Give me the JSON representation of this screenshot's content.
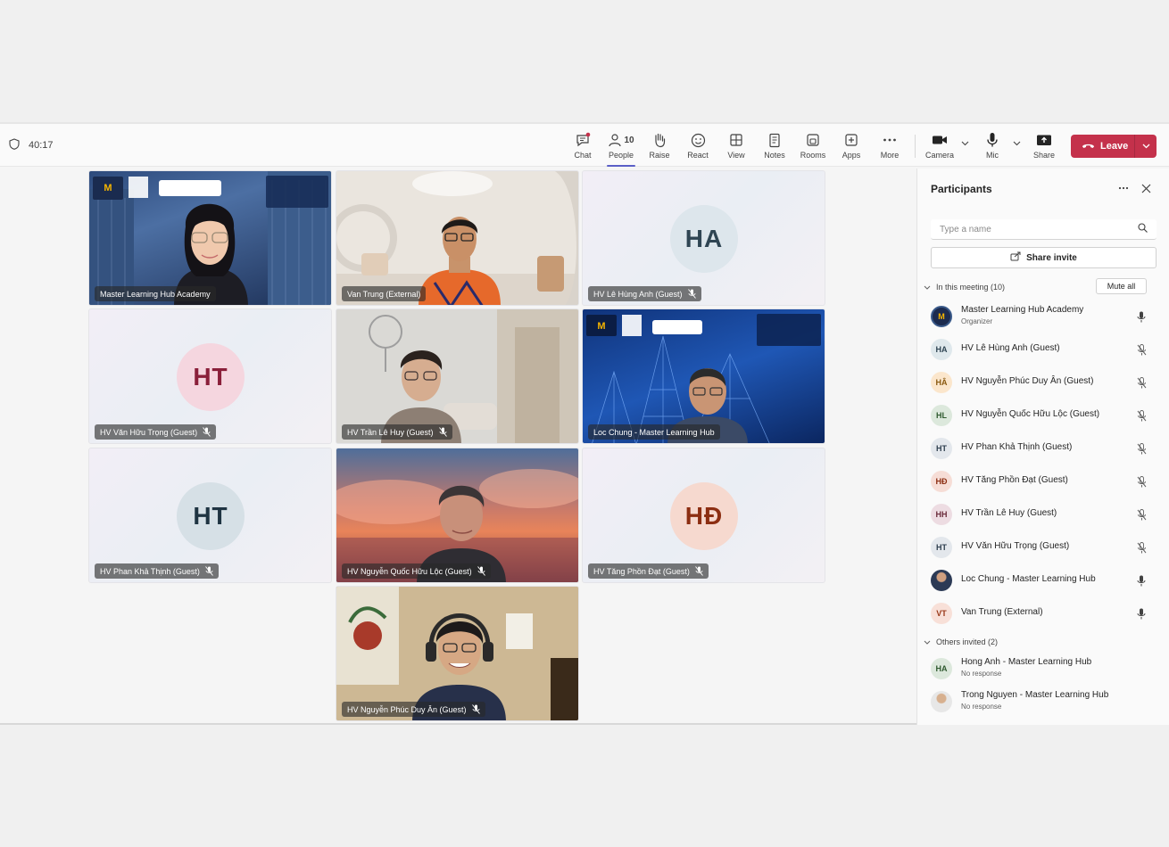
{
  "meeting": {
    "timer": "40:17"
  },
  "toolbar": {
    "chat": "Chat",
    "people": "People",
    "people_count": "10",
    "raise": "Raise",
    "react": "React",
    "view": "View",
    "notes": "Notes",
    "rooms": "Rooms",
    "apps": "Apps",
    "more": "More",
    "camera": "Camera",
    "mic": "Mic",
    "share": "Share",
    "leave": "Leave"
  },
  "tiles": [
    {
      "name": "Master Learning Hub Academy",
      "muted": false,
      "video": true
    },
    {
      "name": "Van Trung (External)",
      "muted": false,
      "video": true
    },
    {
      "name": "HV Lê Hùng Anh (Guest)",
      "muted": true,
      "initials": "HA"
    },
    {
      "name": "HV Văn Hữu Trọng (Guest)",
      "muted": true,
      "initials": "HT"
    },
    {
      "name": "HV Trần Lê Huy (Guest)",
      "muted": true,
      "video": true
    },
    {
      "name": "Loc Chung - Master Learning Hub",
      "muted": false,
      "video": true
    },
    {
      "name": "HV Phan Khả Thịnh (Guest)",
      "muted": true,
      "initials": "HT"
    },
    {
      "name": "HV Nguyễn Quốc Hữu Lộc (Guest)",
      "muted": true,
      "video": true
    },
    {
      "name": "HV Tăng Phồn Đạt (Guest)",
      "muted": true,
      "initials": "HĐ"
    },
    {
      "name": "HV Nguyễn Phúc Duy Ân (Guest)",
      "muted": true,
      "video": true
    }
  ],
  "panel": {
    "title": "Participants",
    "search_placeholder": "Type a name",
    "share_invite": "Share invite",
    "in_meeting": "In this meeting (10)",
    "mute_all": "Mute all",
    "others_invited": "Others invited (2)",
    "participants": [
      {
        "name": "Master Learning Hub Academy",
        "sub": "Organizer",
        "initials": "M",
        "muted": false
      },
      {
        "name": "HV Lê Hùng Anh (Guest)",
        "initials": "HA",
        "muted": true
      },
      {
        "name": "HV Nguyễn Phúc Duy Ân (Guest)",
        "initials": "HÂ",
        "muted": true
      },
      {
        "name": "HV Nguyễn Quốc Hữu Lộc (Guest)",
        "initials": "HL",
        "muted": true
      },
      {
        "name": "HV Phan Khả Thịnh (Guest)",
        "initials": "HT",
        "muted": true
      },
      {
        "name": "HV Tăng Phồn Đạt (Guest)",
        "initials": "HĐ",
        "muted": true
      },
      {
        "name": "HV Trần Lê Huy (Guest)",
        "initials": "HH",
        "muted": true
      },
      {
        "name": "HV Văn Hữu Trọng (Guest)",
        "initials": "HT",
        "muted": true
      },
      {
        "name": "Loc Chung - Master Learning Hub",
        "initials": "",
        "muted": false
      },
      {
        "name": "Van Trung (External)",
        "initials": "VT",
        "muted": false
      }
    ],
    "invited": [
      {
        "name": "Hong Anh - Master Learning Hub",
        "sub": "No response",
        "initials": "HA"
      },
      {
        "name": "Trong Nguyen - Master Learning Hub",
        "sub": "No response",
        "initials": ""
      }
    ]
  }
}
